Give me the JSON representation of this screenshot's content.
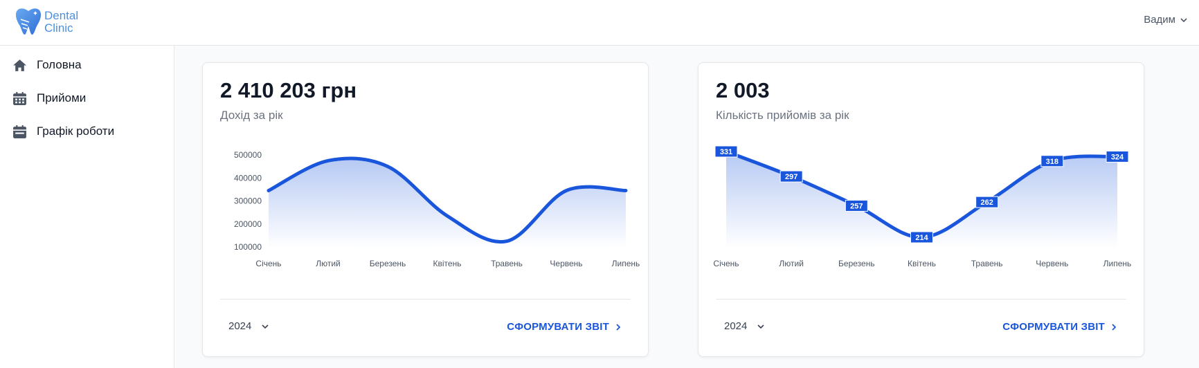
{
  "header": {
    "logo_line1": "Dental",
    "logo_line2": "Clinic",
    "user_name": "Вадим",
    "accent_color": "#4a90e2"
  },
  "sidebar": {
    "items": [
      {
        "label": "Головна",
        "icon": "home-icon"
      },
      {
        "label": "Прийоми",
        "icon": "calendar-grid-icon"
      },
      {
        "label": "Графік роботи",
        "icon": "calendar-icon"
      }
    ]
  },
  "cards": [
    {
      "value": "2 410 203 грн",
      "subtitle": "Дохід за рік",
      "year": "2024",
      "report_label": "СФОРМУВАТИ ЗВІТ",
      "line_color": "#1a56db"
    },
    {
      "value": "2 003",
      "subtitle": "Кількість прийомів за рік",
      "year": "2024",
      "report_label": "СФОРМУВАТИ ЗВІТ",
      "line_color": "#1a56db"
    }
  ],
  "chart_data": [
    {
      "type": "area",
      "categories": [
        "Січень",
        "Лютий",
        "Березень",
        "Квітень",
        "Травень",
        "Червень",
        "Липень"
      ],
      "series": [
        {
          "values": [
            345000,
            475000,
            450000,
            235000,
            125000,
            345000,
            345000
          ]
        }
      ],
      "yticks": [
        "500000",
        "400000",
        "300000",
        "200000",
        "100000"
      ],
      "ylim": [
        100000,
        500000
      ],
      "grid": false,
      "data_labels": false
    },
    {
      "type": "area",
      "categories": [
        "Січень",
        "Лютий",
        "Березень",
        "Квітень",
        "Травень",
        "Червень",
        "Липень"
      ],
      "series": [
        {
          "values": [
            331,
            297,
            257,
            214,
            262,
            318,
            324
          ]
        }
      ],
      "data_labels_text": [
        "331",
        "297",
        "257",
        "214",
        "262",
        "318",
        "324"
      ],
      "ylim": [
        214,
        331
      ],
      "grid": false,
      "data_labels": true,
      "y_axis_visible": false
    }
  ]
}
